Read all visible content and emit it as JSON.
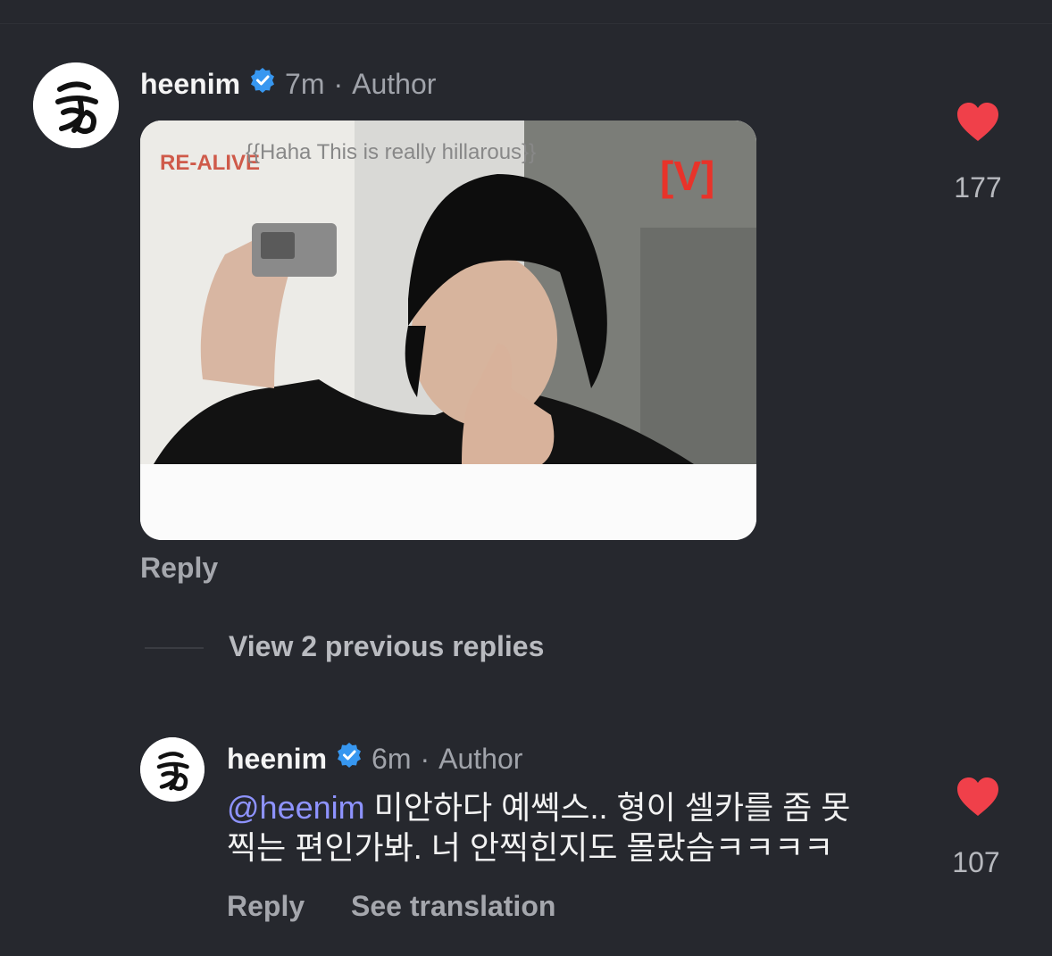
{
  "comment": {
    "username": "heenim",
    "time": "7m",
    "separator": "·",
    "role": "Author",
    "like_count": "177",
    "reply_label": "Reply",
    "media": {
      "caption": "{{Haha This is really hillarous}}",
      "channel_logo": "[V]",
      "watermark": "RE-ALIVE"
    }
  },
  "view_previous": "View 2 previous replies",
  "reply": {
    "username": "heenim",
    "time": "6m",
    "separator": "·",
    "role": "Author",
    "mention": "@heenim",
    "text_line1": " 미안하다 예쎅스.. 형이 셀카를 좀 못",
    "text_line2": "찍는 편인가봐. 너 안찍힌지도 몰랐슴ㅋㅋㅋㅋ",
    "like_count": "107",
    "reply_label": "Reply",
    "translate_label": "See translation"
  },
  "colors": {
    "background": "#26282e",
    "heart": "#f0404a",
    "verified": "#3797f0",
    "mention": "#8e93ff"
  },
  "icons": [
    "avatar-icon",
    "verified-badge-icon",
    "heart-icon"
  ]
}
